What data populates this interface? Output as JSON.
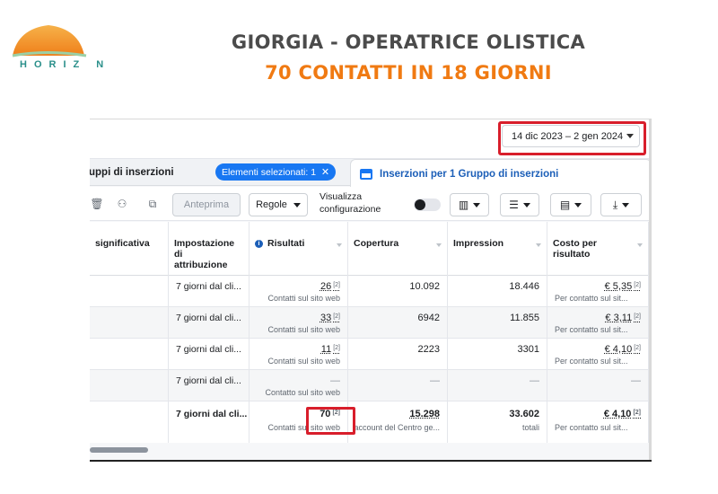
{
  "brand": {
    "logo_text": "HORIZ N"
  },
  "headline": {
    "line1": "GIORGIA - OPERATRICE OLISTICA",
    "line2": "70 CONTATTI IN 18 GIORNI"
  },
  "date_range": "14 dic 2023 – 2 gen 2024",
  "tabs": {
    "left_label": "uppi di inserzioni",
    "selected_pill": "Elementi selezionati: 1",
    "right_label": "Inserzioni per 1 Gruppo di inserzioni"
  },
  "toolbar": {
    "preview_label": "Anteprima",
    "rules_label": "Regole",
    "visualizza_line1": "Visualizza",
    "visualizza_line2": "configurazione"
  },
  "columns": {
    "col0": "significativa",
    "col1_l1": "Impostazione di",
    "col1_l2": "attribuzione",
    "col2": "Risultati",
    "col3": "Copertura",
    "col4": "Impression",
    "col5_l1": "Costo per",
    "col5_l2": "risultato"
  },
  "rows": [
    {
      "attr": "7 giorni dal cli...",
      "results": "26",
      "results_sub": "Contatti sul sito web",
      "reach": "10.092",
      "impr": "18.446",
      "cost": "€ 5,35",
      "cost_sub": "Per contatto sul sit..."
    },
    {
      "attr": "7 giorni dal cli...",
      "results": "33",
      "results_sub": "Contatti sul sito web",
      "reach": "6942",
      "impr": "11.855",
      "cost": "€ 3,11",
      "cost_sub": "Per contatto sul sit..."
    },
    {
      "attr": "7 giorni dal cli...",
      "results": "11",
      "results_sub": "Contatti sul sito web",
      "reach": "2223",
      "impr": "3301",
      "cost": "€ 4,10",
      "cost_sub": "Per contatto sul sit..."
    },
    {
      "attr": "7 giorni dal cli...",
      "results": "—",
      "results_sub": "Contatto sul sito web",
      "reach": "—",
      "impr": "—",
      "cost": "—"
    }
  ],
  "total": {
    "attr": "7 giorni dal cli...",
    "results": "70",
    "results_sub": "Contatti sul sito web",
    "reach": "15.298",
    "reach_sub": "account del Centro ge...",
    "impr": "33.602",
    "impr_sub": "totali",
    "cost": "€ 4,10",
    "cost_sub": "Per contatto sul sit..."
  },
  "superscript": "[2]",
  "colors": {
    "accent_orange": "#f07a12",
    "heading_gray": "#4b4b4b",
    "highlight_red": "#d81e2b",
    "fb_blue": "#1877f2"
  }
}
